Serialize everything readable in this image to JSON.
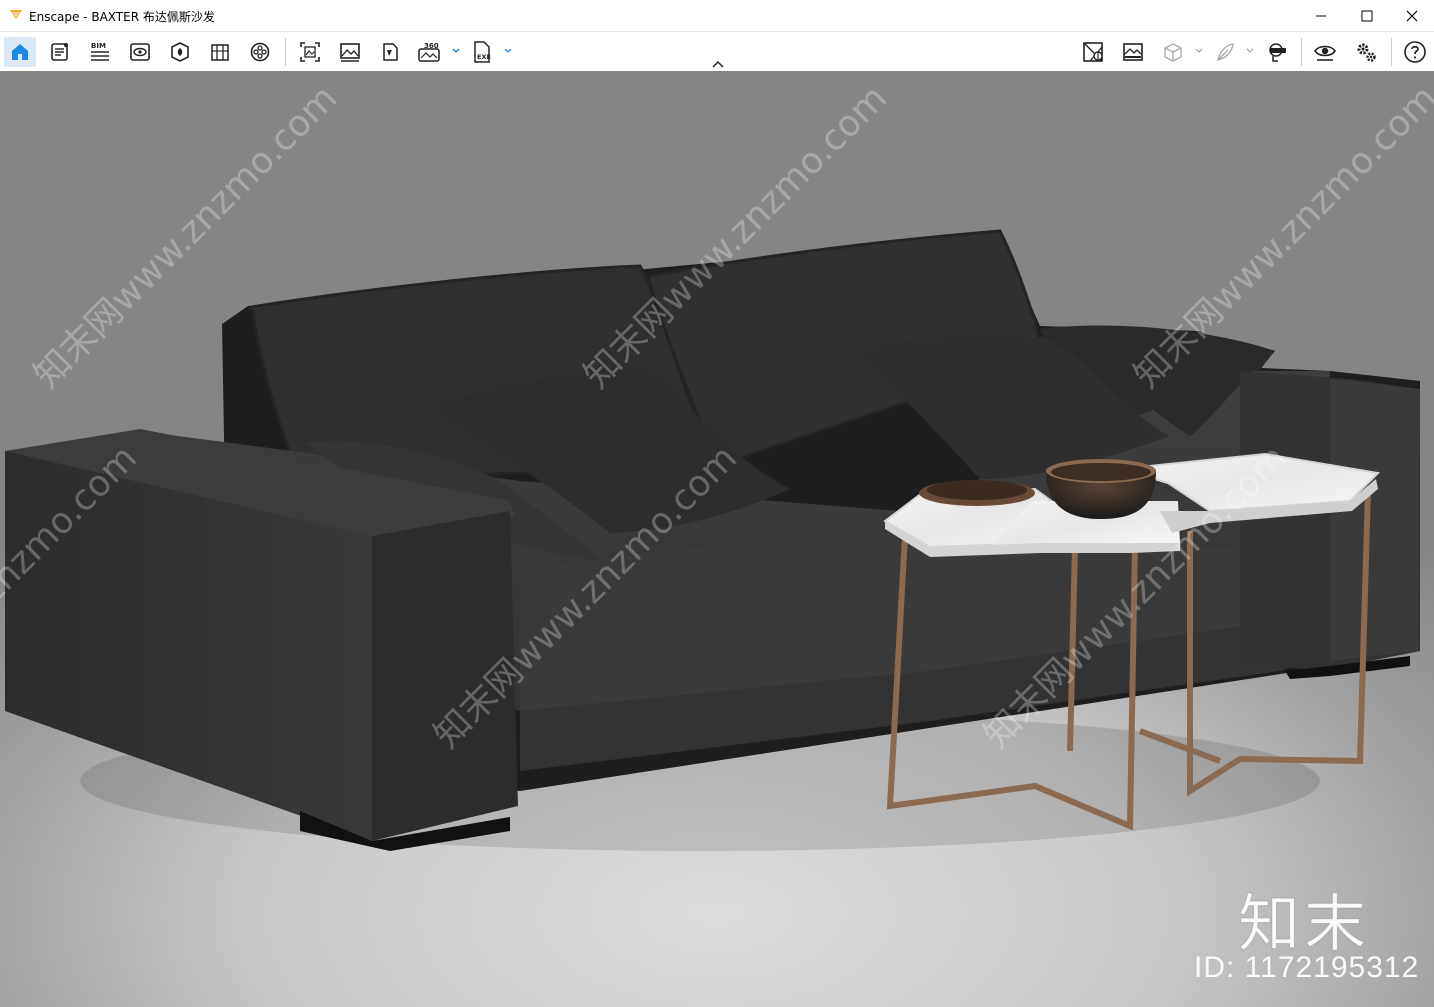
{
  "window": {
    "title": "Enscape - BAXTER 布达佩斯沙发",
    "controls": [
      "minimize-icon",
      "maximize-icon",
      "close-icon"
    ]
  },
  "toolbar": {
    "left_icons": [
      "home-icon",
      "project-notes-icon",
      "bim-icon",
      "views-icon",
      "asset-library-icon",
      "material-editor-icon",
      "video-editor-icon",
      "screenshot-icon",
      "batch-render-icon",
      "panorama-icon",
      "360-panorama-icon",
      "export-exe-icon"
    ],
    "bim_label": "BIM",
    "panorama_label": "360",
    "exe_label": "EXE",
    "right_icons": [
      "site-context-icon",
      "visual-settings-icon",
      "cube-view-icon",
      "feather-icon",
      "vr-headset-icon",
      "live-view-icon",
      "settings-icon",
      "help-icon"
    ]
  },
  "accent_color": "#1e88e5",
  "watermark": {
    "repeat_text": "知末网www.znzmo.com",
    "brand": "知末",
    "id": "ID: 1172195312"
  }
}
